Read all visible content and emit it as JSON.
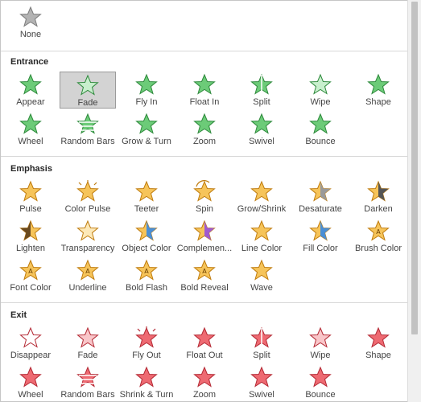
{
  "none_item": {
    "label": "None"
  },
  "sections": {
    "entrance": {
      "title": "Entrance",
      "row1": [
        "Appear",
        "Fade",
        "Fly In",
        "Float In",
        "Split",
        "Wipe",
        "Shape"
      ],
      "row2": [
        "Wheel",
        "Random Bars",
        "Grow & Turn",
        "Zoom",
        "Swivel",
        "Bounce"
      ]
    },
    "emphasis": {
      "title": "Emphasis",
      "row1": [
        "Pulse",
        "Color Pulse",
        "Teeter",
        "Spin",
        "Grow/Shrink",
        "Desaturate",
        "Darken"
      ],
      "row2": [
        "Lighten",
        "Transparency",
        "Object Color",
        "Complemen...",
        "Line Color",
        "Fill Color",
        "Brush Color"
      ],
      "row3": [
        "Font Color",
        "Underline",
        "Bold Flash",
        "Bold Reveal",
        "Wave"
      ]
    },
    "exit": {
      "title": "Exit",
      "row1": [
        "Disappear",
        "Fade",
        "Fly Out",
        "Float Out",
        "Split",
        "Wipe",
        "Shape"
      ],
      "row2": [
        "Wheel",
        "Random Bars",
        "Shrink & Turn",
        "Zoom",
        "Swivel",
        "Bounce"
      ]
    }
  },
  "colors": {
    "entrance": "#4caf5a",
    "emphasis": "#f0b040",
    "exit": "#e04a55",
    "none": "#9a9a9a",
    "selection_bg": "#d3d3d3"
  },
  "selected": "Fade (Entrance)"
}
